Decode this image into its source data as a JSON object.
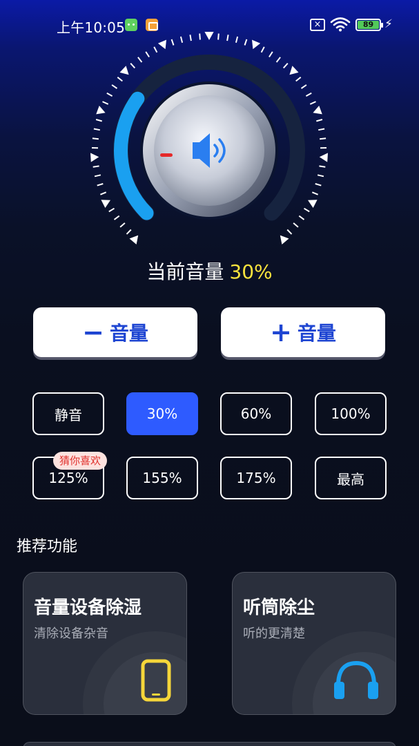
{
  "status_bar": {
    "time": "上午10:05",
    "battery": "89",
    "icons": [
      "android-icon",
      "calendar-icon",
      "sim-off-icon",
      "wifi-icon",
      "battery-icon",
      "charging-bolt-icon"
    ]
  },
  "dial": {
    "volume_level_percent": 30,
    "indicator_color": "#e5292a",
    "arc_fill_color": "#1aa0f0",
    "speaker_icon_color": "#2a7ef0"
  },
  "current_volume": {
    "label": "当前音量",
    "value": "30%",
    "value_color": "#f8e23d"
  },
  "controls": {
    "minus_symbol": "−",
    "minus_label": "音量",
    "plus_symbol": "+",
    "plus_label": "音量"
  },
  "presets": [
    {
      "label": "静音",
      "active": false
    },
    {
      "label": "30%",
      "active": true
    },
    {
      "label": "60%",
      "active": false
    },
    {
      "label": "100%",
      "active": false
    },
    {
      "label": "125%",
      "active": false
    },
    {
      "label": "155%",
      "active": false
    },
    {
      "label": "175%",
      "active": false
    },
    {
      "label": "最高",
      "active": false
    }
  ],
  "preset_tag": "猜你喜欢",
  "recommend": {
    "title": "推荐功能",
    "cards": [
      {
        "title": "音量设备除湿",
        "subtitle": "清除设备杂音",
        "icon": "phone-icon",
        "icon_color": "#f5d63a"
      },
      {
        "title": "听筒除尘",
        "subtitle": "听的更清楚",
        "icon": "headphones-icon",
        "icon_color": "#1aa0f0"
      }
    ]
  },
  "colors": {
    "accent": "#2e5bff",
    "button_text": "#1e45d2",
    "tag_text": "#e0312c"
  }
}
